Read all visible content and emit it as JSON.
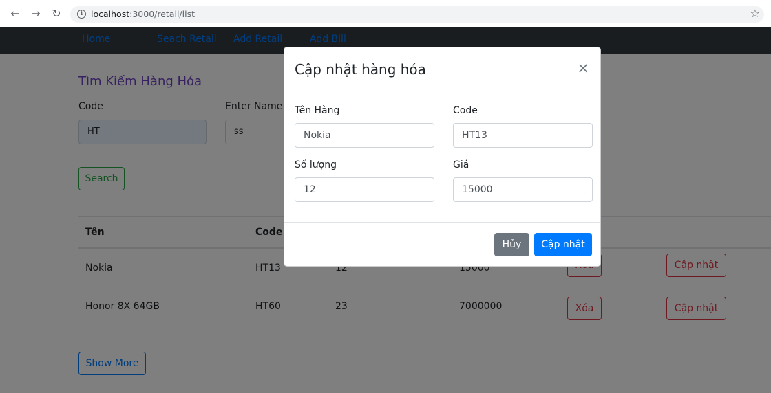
{
  "browser": {
    "url_host": "localhost",
    "url_path": ":3000/retail/list"
  },
  "navbar": {
    "items": [
      "Home",
      "Seach Retail",
      "Add Retail",
      "Add Bill"
    ]
  },
  "search": {
    "title": "Tìm Kiếm Hàng Hóa",
    "code_label": "Code",
    "code_value": "HT",
    "name_label": "Enter Name",
    "name_value": "ss",
    "button": "Search"
  },
  "table": {
    "headers": [
      "Tên",
      "Code"
    ],
    "rows": [
      {
        "name": "Nokia",
        "code": "HT13",
        "qty": "12",
        "price": "15000",
        "delete": "Xóa",
        "update": "Cập nhật"
      },
      {
        "name": "Honor 8X 64GB",
        "code": "HT60",
        "qty": "23",
        "price": "7000000",
        "delete": "Xóa",
        "update": "Cập nhật"
      }
    ],
    "show_more": "Show More"
  },
  "modal": {
    "title": "Cập nhật hàng hóa",
    "close": "×",
    "name_label": "Tên Hàng",
    "name_value": "Nokia",
    "code_label": "Code",
    "code_value": "HT13",
    "qty_label": "Số lượng",
    "qty_value": "12",
    "price_label": "Giá",
    "price_value": "15000",
    "cancel": "Hủy",
    "submit": "Cập nhật"
  },
  "colors": {
    "navbar_bg": "#343a40",
    "primary": "#007bff",
    "danger": "#dc3545",
    "success": "#28a745",
    "secondary": "#6c757d",
    "title_purple": "#6f42c1"
  }
}
